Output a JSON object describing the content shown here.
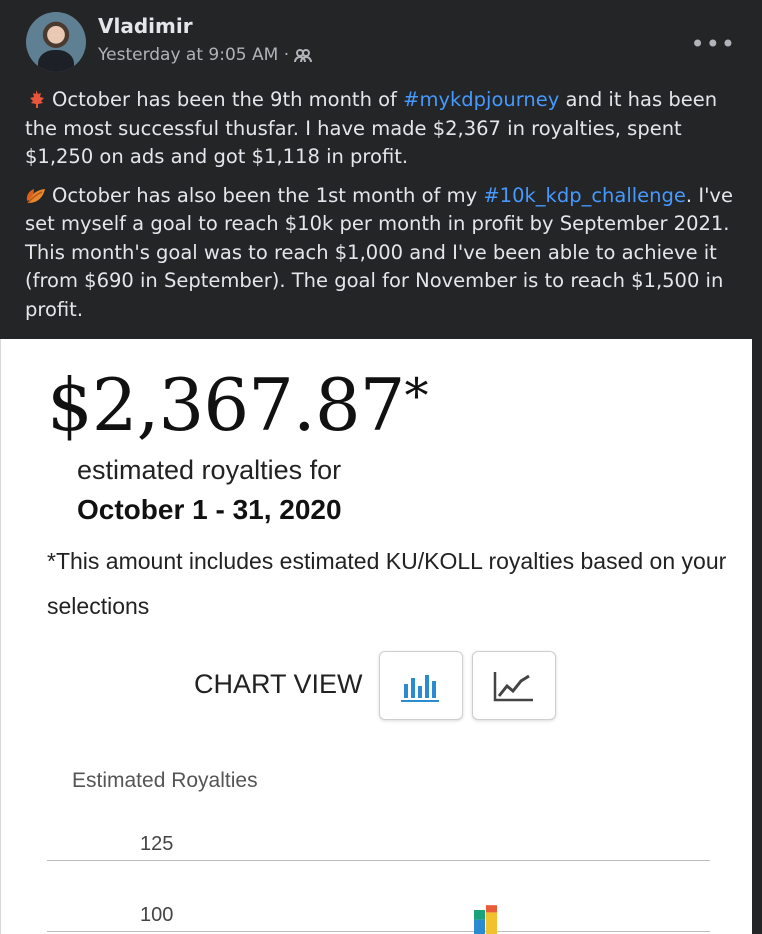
{
  "post": {
    "author": "Vladimir",
    "timestamp": "Yesterday at 9:05 AM · ",
    "audience_icon": "friends-icon",
    "more_label": "•••",
    "paragraphs": [
      {
        "icon": "maple-leaf-icon",
        "text_before": "October has been the 9th month of ",
        "hashtag": "#mykdpjourney",
        "text_after": " and it has been the most successful thusfar. I have made $2,367 in royalties, spent $1,250 on ads and got $1,118 in profit."
      },
      {
        "icon": "fallen-leaf-icon",
        "text_before": "October has also been the 1st month of my ",
        "hashtag": "#10k_kdp_challenge",
        "text_after": ". I've set myself a goal to reach $10k per month in profit by September 2021. This month's goal was to reach $1,000 and I've been able to achieve it (from $690 in September). The goal for November is to reach $1,500 in profit."
      }
    ]
  },
  "screenshot": {
    "amount": "$2,367.87",
    "amount_star": "*",
    "est_label": "estimated royalties for",
    "date_range": "October 1 - 31, 2020",
    "note": "*This amount includes estimated KU/KOLL royalties based on your selections",
    "chart_view_label": "CHART VIEW",
    "buttons": [
      {
        "icon": "bar-chart-icon",
        "active": true
      },
      {
        "icon": "line-chart-icon",
        "active": false
      }
    ],
    "accent_color": "#2a8bd0"
  },
  "chart_data": {
    "type": "bar",
    "title": "Estimated Royalties",
    "y_ticks": [
      125,
      100
    ],
    "visible_bar": {
      "segments": [
        {
          "color": "#2a8bd0",
          "value": 6
        },
        {
          "color": "#1aa37a",
          "value": 4
        },
        {
          "color": "#f2c12e",
          "value": 9
        },
        {
          "color": "#e85c3a",
          "value": 3
        }
      ]
    }
  }
}
